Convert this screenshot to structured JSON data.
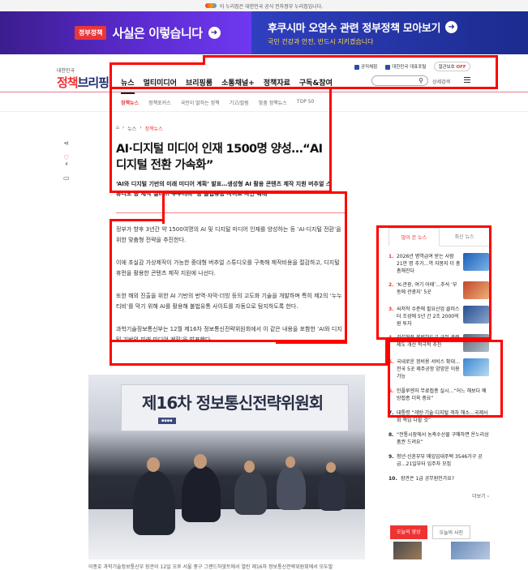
{
  "gov_strip": "이 누리집은 대한민국 공식 전자정부 누리집입니다.",
  "ad": {
    "badge": "정부정책",
    "title": "사실은 이렇습니다",
    "right_title": "후쿠시마 오염수 관련 정부정책 모아보기",
    "right_sub": "국민 건강과 안전, 반드시 지키겠습니다"
  },
  "logo": {
    "small": "대한민국",
    "big_a": "정책",
    "big_b": "브리핑"
  },
  "util": {
    "item1": "공직체험",
    "item2": "대한민국 대표포털",
    "pill_label": "절관보호",
    "pill_state": "OFF"
  },
  "gnb": [
    "뉴스",
    "멀티미디어",
    "브리핑룸",
    "소통채널+",
    "정책자료",
    "구독&참여"
  ],
  "search": {
    "detail": "상세검색"
  },
  "sub_nav": [
    "정책뉴스",
    "정책포커스",
    "국민이 말하는 정책",
    "기고/칼럼",
    "맞춤 정책뉴스",
    "TOP 50"
  ],
  "side": {
    "like_count": "4"
  },
  "crumb": {
    "a": "뉴스",
    "b": "정책뉴스"
  },
  "article": {
    "headline": "AI·디지털 미디어 인재 1500명 양성…“AI 디지털 전환 가속화”",
    "dek": "‘AI와 디지털 기반의 미래 미디어 계획’ 발표…생성형 AI 활용 콘텐츠 제작 지원 버추얼 스튜디오 등 제작 설비…‘누누티비’ 등 불법유통 사이트 차단 확대",
    "p1": "정부가 향후 3년간 약 1500여명의 AI 및 디지털 미디어 인재를 양성하는 등 ‘AI·디지털 전환’을 위한 맞춤형 전략을 추진한다.",
    "p2": "이에 초실감 가상제작이 가능한 중대형 버추얼 스튜디오를 구축해 제작비용을 절감하고, 디지털 휴먼을 활용한 콘텐츠 제작 지원에 나선다.",
    "p3": "또한 해외 진출을 위한 AI 기반의 번역·자막·더빙 등의 고도화 기술을 개발하며 특히 제2의 ‘누누티비’를 막기 위해 AI를 활용해 불법유통 사이트를 자동으로 탐지하도록 한다.",
    "p4": "과학기술정보통신부는 12월 제16차 정보통신전략위원회에서 이 같은 내용을 포함한 ‘AI와 디지털 기반의 미래 미디어 계획’을 발표했다.",
    "photo_title": "제16차 정보통신전략위원회",
    "caption": "이종호 과학기술정보통신부 장관이 12일 오후 서울 중구 그랜드하얏트에서 열린 제16차 정보통신전략위원회에서 모두발"
  },
  "rank": {
    "tab_on": "많이 본 뉴스",
    "tab_off": "최신 뉴스",
    "items": [
      {
        "n": "1.",
        "text": "2026년 병역급여 받는 사람 21만 명 추가…역 자봉지 더 충촘해진다",
        "color": "#2e7bd6"
      },
      {
        "n": "2.",
        "text": "‘K-관광, 여기 어때’…추석 ‘부동에 관광지’ 5곳",
        "color": "#d85a3a"
      },
      {
        "n": "3.",
        "text": "씨저작 수준에 필요산업 클러스터 조성에 5년 간 2조 2000억 원 투자",
        "color": "#2b5fa8"
      },
      {
        "n": "4.",
        "text": "건설현장 불법하도급 근절 관련 제도 개선 적극적 추진",
        "color": "#7a8a98"
      },
      {
        "n": "5.",
        "text": "국내로운 정비용 서비스 확대…전국 5곳 제주공항 양양운 이용 가능",
        "color": "#5fa0d8"
      },
      {
        "n": "6.",
        "text": "인플루엔자 무료접종 실시…“어느 해보다 예방접종 더욱 중요”",
        "color": ""
      },
      {
        "n": "7.",
        "text": "대통령 “개방·기술·디지털 격차 해소…국제사회 책임 다할 것”",
        "color": ""
      },
      {
        "n": "8.",
        "text": "“전통시장에서 농축수산물 구매하면 온누리상품권 드려요”",
        "color": ""
      },
      {
        "n": "9.",
        "text": "청년·신혼부부 매입임대주택 3546가구 공급…21일부터 입주자 모집",
        "color": ""
      },
      {
        "n": "10.",
        "text": "장관은 1급 공무원인가요?",
        "color": ""
      }
    ],
    "more": "더보기 ›"
  },
  "bottom_tabs": {
    "on": "오늘의 영상",
    "off": "오늘의 사진"
  }
}
